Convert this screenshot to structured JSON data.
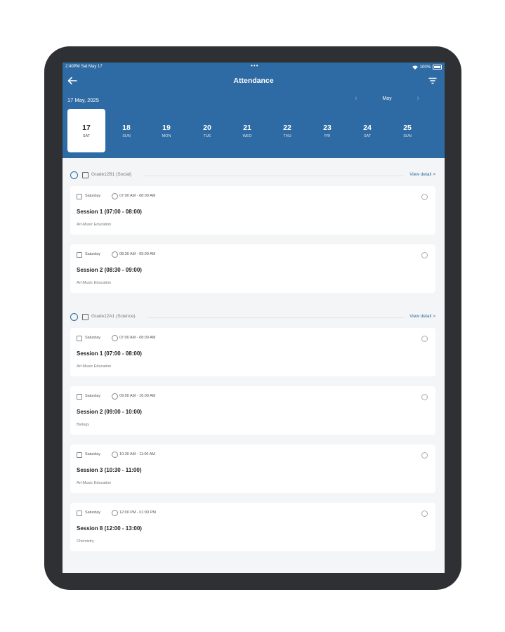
{
  "status_bar": {
    "time": "2:40PM",
    "date": "Sat May 17",
    "dots": "•••",
    "battery": "100%"
  },
  "header": {
    "title": "Attendance",
    "date_label": "17 May, 2025",
    "month": "May"
  },
  "days": [
    {
      "num": "17",
      "name": "SAT",
      "selected": true
    },
    {
      "num": "18",
      "name": "SUN",
      "selected": false
    },
    {
      "num": "19",
      "name": "MON",
      "selected": false
    },
    {
      "num": "20",
      "name": "TUE",
      "selected": false
    },
    {
      "num": "21",
      "name": "WED",
      "selected": false
    },
    {
      "num": "22",
      "name": "THU",
      "selected": false
    },
    {
      "num": "23",
      "name": "FRI",
      "selected": false
    },
    {
      "num": "24",
      "name": "SAT",
      "selected": false
    },
    {
      "num": "25",
      "name": "SUN",
      "selected": false
    }
  ],
  "groups": [
    {
      "label": "Grade12B1 (Social)",
      "link": "View detail >",
      "sessions": [
        {
          "day": "Saturday",
          "time": "07:00 AM - 08:00 AM",
          "title": "Session 1 (07:00 - 08:00)",
          "subject": "Art-Music Education"
        },
        {
          "day": "Saturday",
          "time": "08:30 AM - 09:00 AM",
          "title": "Session 2 (08:30 - 09:00)",
          "subject": "Art-Music Education"
        }
      ]
    },
    {
      "label": "Grade12A1 (Science)",
      "link": "View detail >",
      "sessions": [
        {
          "day": "Saturday",
          "time": "07:00 AM - 08:00 AM",
          "title": "Session 1 (07:00 - 08:00)",
          "subject": "Art-Music Education"
        },
        {
          "day": "Saturday",
          "time": "09:00 AM - 10:00 AM",
          "title": "Session 2 (09:00 - 10:00)",
          "subject": "Biology"
        },
        {
          "day": "Saturday",
          "time": "10:30 AM - 11:00 AM",
          "title": "Session 3 (10:30 - 11:00)",
          "subject": "Art-Music Education"
        },
        {
          "day": "Saturday",
          "time": "12:00 PM - 01:00 PM",
          "title": "Session 8 (12:00 - 13:00)",
          "subject": "Chemistry"
        }
      ]
    }
  ],
  "colors": {
    "header": "#2e6aa3",
    "device_frame": "#2f3033",
    "background": "#f4f5f7"
  }
}
